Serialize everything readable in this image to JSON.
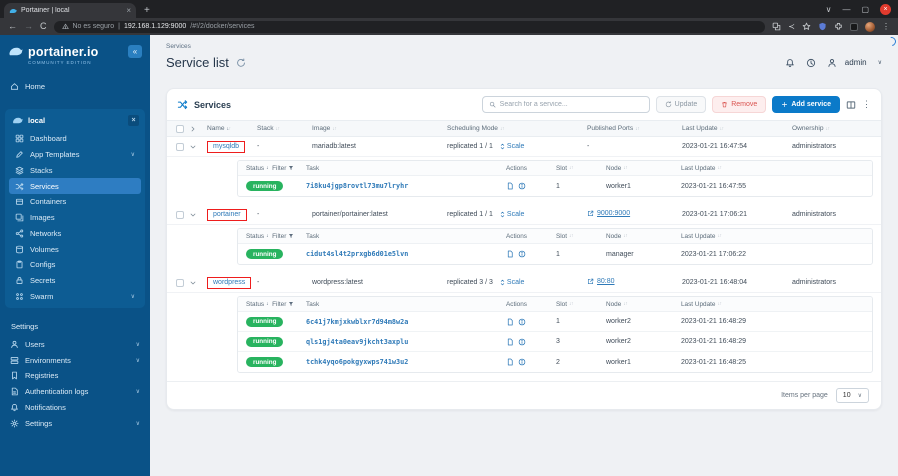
{
  "browser": {
    "tab_title": "Portainer | local",
    "security_text": "No es seguro",
    "url_host": "192.168.1.129:9000",
    "url_path": "/#!/2/docker/services"
  },
  "sidebar": {
    "logo": "portainer.io",
    "edition": "COMMUNITY EDITION",
    "collapse_glyph": "«",
    "home_label": "Home",
    "environment": {
      "name": "local",
      "items": [
        {
          "label": "Dashboard",
          "icon": "dashboard-icon",
          "chevron": false,
          "active": false
        },
        {
          "label": "App Templates",
          "icon": "edit-icon",
          "chevron": true,
          "active": false
        },
        {
          "label": "Stacks",
          "icon": "layers-icon",
          "chevron": false,
          "active": false
        },
        {
          "label": "Services",
          "icon": "shuffle-icon",
          "chevron": false,
          "active": true
        },
        {
          "label": "Containers",
          "icon": "box-icon",
          "chevron": false,
          "active": false
        },
        {
          "label": "Images",
          "icon": "images-icon",
          "chevron": false,
          "active": false
        },
        {
          "label": "Networks",
          "icon": "share-nodes-icon",
          "chevron": false,
          "active": false
        },
        {
          "label": "Volumes",
          "icon": "database-icon",
          "chevron": false,
          "active": false
        },
        {
          "label": "Configs",
          "icon": "clipboard-icon",
          "chevron": false,
          "active": false
        },
        {
          "label": "Secrets",
          "icon": "lock-icon",
          "chevron": false,
          "active": false
        },
        {
          "label": "Swarm",
          "icon": "grid-dots-icon",
          "chevron": true,
          "active": false
        }
      ]
    },
    "settings_header": "Settings",
    "settings_items": [
      {
        "label": "Users",
        "icon": "person-icon",
        "chevron": true,
        "active": false
      },
      {
        "label": "Environments",
        "icon": "drives-icon",
        "chevron": true,
        "active": false
      },
      {
        "label": "Registries",
        "icon": "bookmark-icon",
        "chevron": false,
        "active": false
      },
      {
        "label": "Authentication logs",
        "icon": "file-icon",
        "chevron": true,
        "active": false
      },
      {
        "label": "Notifications",
        "icon": "bell-icon",
        "chevron": false,
        "active": false
      },
      {
        "label": "Settings",
        "icon": "gear-icon",
        "chevron": true,
        "active": false
      }
    ]
  },
  "header": {
    "breadcrumb": "Services",
    "title": "Service list",
    "user": "admin"
  },
  "services_panel": {
    "title": "Services",
    "search_placeholder": "Search for a service...",
    "buttons": {
      "update": "Update",
      "remove": "Remove",
      "add": "Add service"
    },
    "columns": [
      "Name",
      "Stack",
      "Image",
      "Scheduling Mode",
      "Published Ports",
      "Last Update",
      "Ownership"
    ],
    "task_columns": [
      "Status",
      "Filter",
      "Task",
      "Actions",
      "Slot",
      "Node",
      "Last Update"
    ],
    "scale_label": "Scale",
    "items_per_page_label": "Items per page",
    "items_per_page_value": "10",
    "accent_color": "#0b7ac9",
    "running_color": "#28b35f",
    "annotation_color": "#ee1d1d",
    "services": [
      {
        "name": "mysqldb",
        "annotated": true,
        "stack": "-",
        "image": "mariadb:latest",
        "scheduling_mode": "replicated 1 / 1",
        "published_ports": "-",
        "last_update": "2023-01-21 16:47:54",
        "ownership": "administrators",
        "tasks": [
          {
            "status": "running",
            "id": "7i8ku4jgp8rovtl73mu7lryhr",
            "slot": "1",
            "node": "worker1",
            "last_update": "2023-01-21 16:47:55"
          }
        ]
      },
      {
        "name": "portainer",
        "annotated": true,
        "stack": "-",
        "image": "portainer/portainer:latest",
        "scheduling_mode": "replicated 1 / 1",
        "published_ports": "9000:9000",
        "last_update": "2023-01-21 17:06:21",
        "ownership": "administrators",
        "tasks": [
          {
            "status": "running",
            "id": "cidut4sl4t2prxgb6d01e5lvn",
            "slot": "1",
            "node": "manager",
            "last_update": "2023-01-21 17:06:22"
          }
        ]
      },
      {
        "name": "wordpress",
        "annotated": true,
        "stack": "-",
        "image": "wordpress:latest",
        "scheduling_mode": "replicated 3 / 3",
        "published_ports": "80:80",
        "last_update": "2023-01-21 16:48:04",
        "ownership": "administrators",
        "tasks": [
          {
            "status": "running",
            "id": "6c41j7kmjxkwblxr7d94m8w2a",
            "slot": "1",
            "node": "worker2",
            "last_update": "2023-01-21 16:48:29"
          },
          {
            "status": "running",
            "id": "qls1gj4ta0eav9jkcht3axplu",
            "slot": "3",
            "node": "worker2",
            "last_update": "2023-01-21 16:48:29"
          },
          {
            "status": "running",
            "id": "tchk4yqo6pokgyxwps741w3u2",
            "slot": "2",
            "node": "worker1",
            "last_update": "2023-01-21 16:48:25"
          }
        ]
      }
    ]
  }
}
